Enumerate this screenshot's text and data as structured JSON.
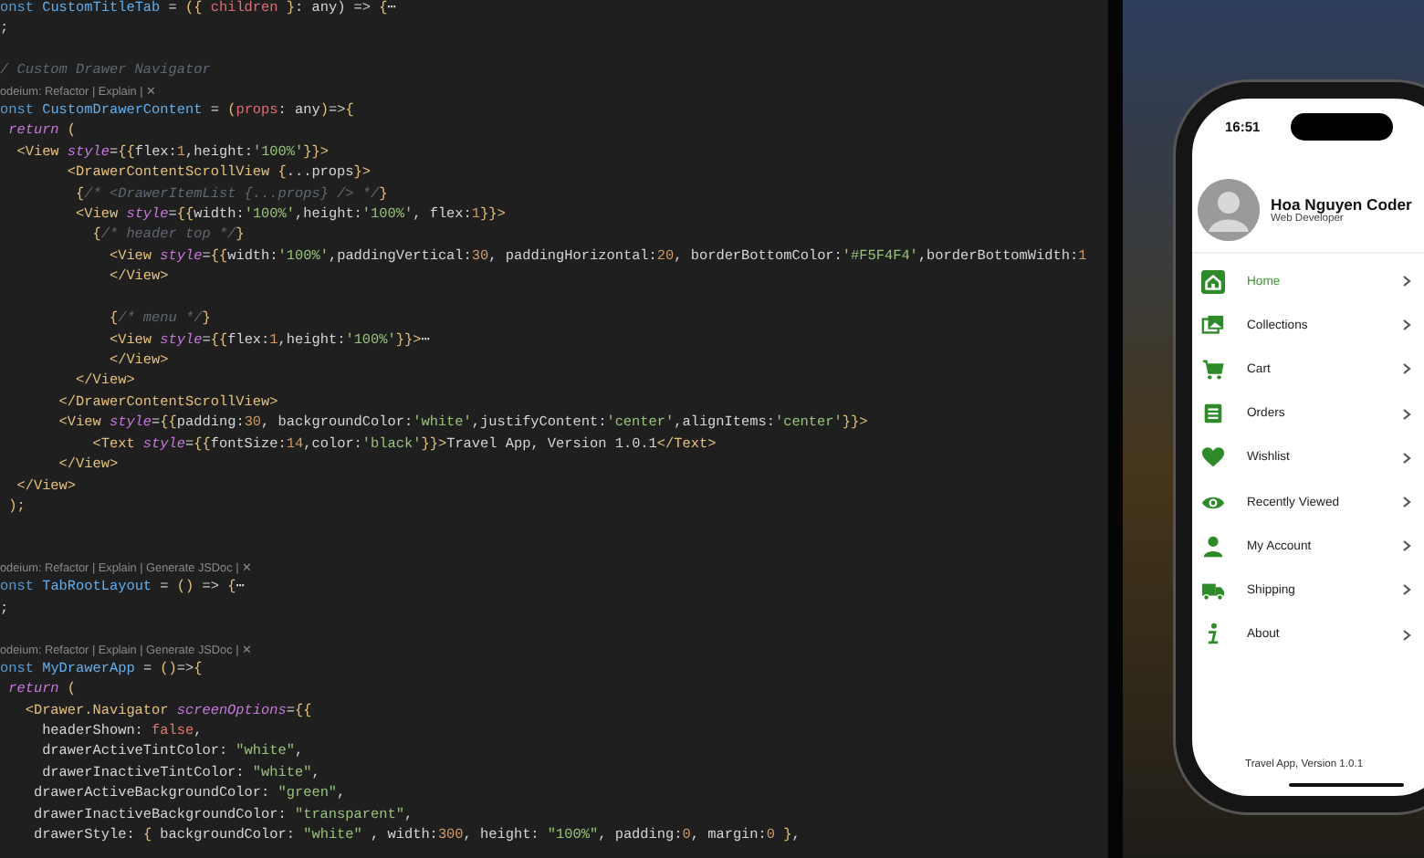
{
  "editor": {
    "lines": [
      {
        "kind": "code",
        "tokens": [
          {
            "text": "onst ",
            "kind": "keyword"
          },
          {
            "text": "CustomTitleTab",
            "kind": "name"
          },
          {
            "text": " = ",
            "kind": "operator"
          },
          {
            "text": "({ ",
            "kind": "brace"
          },
          {
            "text": "children",
            "kind": "param"
          },
          {
            "text": " }",
            "kind": "brace"
          },
          {
            "text": ": any) ",
            "kind": "plain"
          },
          {
            "text": "=>",
            "kind": "operator"
          },
          {
            "text": " {",
            "kind": "brace"
          },
          {
            "text": "⋯",
            "kind": "plain"
          }
        ]
      },
      {
        "kind": "code",
        "tokens": [
          {
            "text": ";",
            "kind": "plain"
          }
        ]
      },
      {
        "kind": "blank"
      },
      {
        "kind": "code",
        "tokens": [
          {
            "text": "/ Custom Drawer Navigator",
            "kind": "comment"
          }
        ]
      },
      {
        "kind": "codelens",
        "text": "odeium: Refactor | Explain | ✕"
      },
      {
        "kind": "code",
        "tokens": [
          {
            "text": "onst ",
            "kind": "keyword"
          },
          {
            "text": "CustomDrawerContent",
            "kind": "name"
          },
          {
            "text": " = ",
            "kind": "operator"
          },
          {
            "text": "(",
            "kind": "brace"
          },
          {
            "text": "props",
            "kind": "param"
          },
          {
            "text": ": any",
            "kind": "plain"
          },
          {
            "text": ")",
            "kind": "brace"
          },
          {
            "text": "=>",
            "kind": "operator"
          },
          {
            "text": "{",
            "kind": "brace"
          }
        ]
      },
      {
        "kind": "code",
        "tokens": [
          {
            "text": " return",
            "kind": "control"
          },
          {
            "text": " (",
            "kind": "brace"
          }
        ]
      },
      {
        "kind": "code",
        "tokens": [
          {
            "text": "  <View",
            "kind": "tag"
          },
          {
            "text": " style",
            "kind": "attr"
          },
          {
            "text": "=",
            "kind": "operator"
          },
          {
            "text": "{{",
            "kind": "brace"
          },
          {
            "text": "flex:",
            "kind": "plain"
          },
          {
            "text": "1",
            "kind": "number"
          },
          {
            "text": ",height:",
            "kind": "plain"
          },
          {
            "text": "'100%'",
            "kind": "string"
          },
          {
            "text": "}}",
            "kind": "brace"
          },
          {
            "text": ">",
            "kind": "tag"
          }
        ]
      },
      {
        "kind": "code",
        "tokens": [
          {
            "text": "        <DrawerContentScrollView",
            "kind": "tag"
          },
          {
            "text": " {",
            "kind": "brace"
          },
          {
            "text": "...props",
            "kind": "plain"
          },
          {
            "text": "}",
            "kind": "brace"
          },
          {
            "text": ">",
            "kind": "tag"
          }
        ]
      },
      {
        "kind": "code",
        "tokens": [
          {
            "text": "         {",
            "kind": "brace"
          },
          {
            "text": "/* <DrawerItemList {...props} /> */",
            "kind": "comment"
          },
          {
            "text": "}",
            "kind": "brace"
          }
        ]
      },
      {
        "kind": "code",
        "tokens": [
          {
            "text": "         <View",
            "kind": "tag"
          },
          {
            "text": " style",
            "kind": "attr"
          },
          {
            "text": "=",
            "kind": "operator"
          },
          {
            "text": "{{",
            "kind": "brace"
          },
          {
            "text": "width:",
            "kind": "plain"
          },
          {
            "text": "'100%'",
            "kind": "string"
          },
          {
            "text": ",height:",
            "kind": "plain"
          },
          {
            "text": "'100%'",
            "kind": "string"
          },
          {
            "text": ", flex:",
            "kind": "plain"
          },
          {
            "text": "1",
            "kind": "number"
          },
          {
            "text": "}}",
            "kind": "brace"
          },
          {
            "text": ">",
            "kind": "tag"
          }
        ]
      },
      {
        "kind": "code",
        "tokens": [
          {
            "text": "           {",
            "kind": "brace"
          },
          {
            "text": "/* header top */",
            "kind": "comment"
          },
          {
            "text": "}",
            "kind": "brace"
          }
        ]
      },
      {
        "kind": "code",
        "tokens": [
          {
            "text": "             <View",
            "kind": "tag"
          },
          {
            "text": " style",
            "kind": "attr"
          },
          {
            "text": "=",
            "kind": "operator"
          },
          {
            "text": "{{",
            "kind": "brace"
          },
          {
            "text": "width:",
            "kind": "plain"
          },
          {
            "text": "'100%'",
            "kind": "string"
          },
          {
            "text": ",paddingVertical:",
            "kind": "plain"
          },
          {
            "text": "30",
            "kind": "number"
          },
          {
            "text": ", paddingHorizontal:",
            "kind": "plain"
          },
          {
            "text": "20",
            "kind": "number"
          },
          {
            "text": ", borderBottomColor:",
            "kind": "plain"
          },
          {
            "text": "'#F5F4F4'",
            "kind": "string"
          },
          {
            "text": ",borderBottomWidth:",
            "kind": "plain"
          },
          {
            "text": "1",
            "kind": "number"
          }
        ]
      },
      {
        "kind": "code",
        "tokens": [
          {
            "text": "             </View>",
            "kind": "tag"
          }
        ]
      },
      {
        "kind": "blank"
      },
      {
        "kind": "code",
        "tokens": [
          {
            "text": "             {",
            "kind": "brace"
          },
          {
            "text": "/* menu */",
            "kind": "comment"
          },
          {
            "text": "}",
            "kind": "brace"
          }
        ]
      },
      {
        "kind": "code",
        "tokens": [
          {
            "text": "             <View",
            "kind": "tag"
          },
          {
            "text": " style",
            "kind": "attr"
          },
          {
            "text": "=",
            "kind": "operator"
          },
          {
            "text": "{{",
            "kind": "brace"
          },
          {
            "text": "flex:",
            "kind": "plain"
          },
          {
            "text": "1",
            "kind": "number"
          },
          {
            "text": ",height:",
            "kind": "plain"
          },
          {
            "text": "'100%'",
            "kind": "string"
          },
          {
            "text": "}}",
            "kind": "brace"
          },
          {
            "text": ">",
            "kind": "tag"
          },
          {
            "text": "⋯",
            "kind": "plain"
          }
        ]
      },
      {
        "kind": "code",
        "tokens": [
          {
            "text": "             </View>",
            "kind": "tag"
          }
        ]
      },
      {
        "kind": "code",
        "tokens": [
          {
            "text": "         </View>",
            "kind": "tag"
          }
        ]
      },
      {
        "kind": "code",
        "tokens": [
          {
            "text": "       </DrawerContentScrollView>",
            "kind": "tag"
          }
        ]
      },
      {
        "kind": "code",
        "tokens": [
          {
            "text": "       <View",
            "kind": "tag"
          },
          {
            "text": " style",
            "kind": "attr"
          },
          {
            "text": "=",
            "kind": "operator"
          },
          {
            "text": "{{",
            "kind": "brace"
          },
          {
            "text": "padding:",
            "kind": "plain"
          },
          {
            "text": "30",
            "kind": "number"
          },
          {
            "text": ", backgroundColor:",
            "kind": "plain"
          },
          {
            "text": "'white'",
            "kind": "string"
          },
          {
            "text": ",justifyContent:",
            "kind": "plain"
          },
          {
            "text": "'center'",
            "kind": "string"
          },
          {
            "text": ",alignItems:",
            "kind": "plain"
          },
          {
            "text": "'center'",
            "kind": "string"
          },
          {
            "text": "}}",
            "kind": "brace"
          },
          {
            "text": ">",
            "kind": "tag"
          }
        ]
      },
      {
        "kind": "code",
        "tokens": [
          {
            "text": "           <Text",
            "kind": "tag"
          },
          {
            "text": " style",
            "kind": "attr"
          },
          {
            "text": "=",
            "kind": "operator"
          },
          {
            "text": "{{",
            "kind": "brace"
          },
          {
            "text": "fontSize:",
            "kind": "plain"
          },
          {
            "text": "14",
            "kind": "number"
          },
          {
            "text": ",color:",
            "kind": "plain"
          },
          {
            "text": "'black'",
            "kind": "string"
          },
          {
            "text": "}}",
            "kind": "brace"
          },
          {
            "text": ">",
            "kind": "tag"
          },
          {
            "text": "Travel App, Version 1.0.1",
            "kind": "plain"
          },
          {
            "text": "</Text>",
            "kind": "tag"
          }
        ]
      },
      {
        "kind": "code",
        "tokens": [
          {
            "text": "       </View>",
            "kind": "tag"
          }
        ]
      },
      {
        "kind": "code",
        "tokens": [
          {
            "text": "  </View>",
            "kind": "tag"
          }
        ]
      },
      {
        "kind": "code",
        "tokens": [
          {
            "text": " );",
            "kind": "brace"
          }
        ]
      },
      {
        "kind": "blank"
      },
      {
        "kind": "blank"
      },
      {
        "kind": "codelens",
        "text": "odeium: Refactor | Explain | Generate JSDoc | ✕"
      },
      {
        "kind": "code",
        "tokens": [
          {
            "text": "onst ",
            "kind": "keyword"
          },
          {
            "text": "TabRootLayout",
            "kind": "name"
          },
          {
            "text": " = ",
            "kind": "operator"
          },
          {
            "text": "() ",
            "kind": "brace"
          },
          {
            "text": "=>",
            "kind": "operator"
          },
          {
            "text": " {",
            "kind": "brace"
          },
          {
            "text": "⋯",
            "kind": "plain"
          }
        ]
      },
      {
        "kind": "code",
        "tokens": [
          {
            "text": ";",
            "kind": "plain"
          }
        ]
      },
      {
        "kind": "blank"
      },
      {
        "kind": "codelens",
        "text": "odeium: Refactor | Explain | Generate JSDoc | ✕"
      },
      {
        "kind": "code",
        "tokens": [
          {
            "text": "onst ",
            "kind": "keyword"
          },
          {
            "text": "MyDrawerApp",
            "kind": "name"
          },
          {
            "text": " = ",
            "kind": "operator"
          },
          {
            "text": "()",
            "kind": "brace"
          },
          {
            "text": "=>",
            "kind": "operator"
          },
          {
            "text": "{",
            "kind": "brace"
          }
        ]
      },
      {
        "kind": "code",
        "tokens": [
          {
            "text": " return",
            "kind": "control"
          },
          {
            "text": " (",
            "kind": "brace"
          }
        ]
      },
      {
        "kind": "code",
        "tokens": [
          {
            "text": "   <Drawer.Navigator",
            "kind": "tag"
          },
          {
            "text": " screenOptions",
            "kind": "attr"
          },
          {
            "text": "=",
            "kind": "operator"
          },
          {
            "text": "{{",
            "kind": "brace"
          }
        ]
      },
      {
        "kind": "code",
        "tokens": [
          {
            "text": "     headerShown: ",
            "kind": "plain"
          },
          {
            "text": "false",
            "kind": "literal"
          },
          {
            "text": ",",
            "kind": "plain"
          }
        ]
      },
      {
        "kind": "code",
        "tokens": [
          {
            "text": "     drawerActiveTintColor: ",
            "kind": "plain"
          },
          {
            "text": "\"white\"",
            "kind": "string"
          },
          {
            "text": ",",
            "kind": "plain"
          }
        ]
      },
      {
        "kind": "code",
        "tokens": [
          {
            "text": "     drawerInactiveTintColor: ",
            "kind": "plain"
          },
          {
            "text": "\"white\"",
            "kind": "string"
          },
          {
            "text": ",",
            "kind": "plain"
          }
        ]
      },
      {
        "kind": "code",
        "tokens": [
          {
            "text": "    drawerActiveBackgroundColor: ",
            "kind": "plain"
          },
          {
            "text": "\"green\"",
            "kind": "string"
          },
          {
            "text": ",",
            "kind": "plain"
          }
        ]
      },
      {
        "kind": "code",
        "tokens": [
          {
            "text": "    drawerInactiveBackgroundColor: ",
            "kind": "plain"
          },
          {
            "text": "\"transparent\"",
            "kind": "string"
          },
          {
            "text": ",",
            "kind": "plain"
          }
        ]
      },
      {
        "kind": "code",
        "tokens": [
          {
            "text": "    drawerStyle: ",
            "kind": "plain"
          },
          {
            "text": "{ ",
            "kind": "brace"
          },
          {
            "text": "backgroundColor: ",
            "kind": "plain"
          },
          {
            "text": "\"white\"",
            "kind": "string"
          },
          {
            "text": " , width:",
            "kind": "plain"
          },
          {
            "text": "300",
            "kind": "number"
          },
          {
            "text": ", height: ",
            "kind": "plain"
          },
          {
            "text": "\"100%\"",
            "kind": "string"
          },
          {
            "text": ", padding:",
            "kind": "plain"
          },
          {
            "text": "0",
            "kind": "number"
          },
          {
            "text": ", margin:",
            "kind": "plain"
          },
          {
            "text": "0",
            "kind": "number"
          },
          {
            "text": " }",
            "kind": "brace"
          },
          {
            "text": ",",
            "kind": "plain"
          }
        ]
      }
    ]
  },
  "phone": {
    "status_time": "16:51",
    "profile": {
      "name": "Hoa Nguyen Coder",
      "role": "Web Developer"
    },
    "menu": [
      {
        "label": "Home",
        "selected": true
      },
      {
        "label": "Collections",
        "selected": false
      },
      {
        "label": "Cart",
        "selected": false
      },
      {
        "label": "Orders",
        "selected": false
      },
      {
        "label": "Wishlist",
        "selected": false
      },
      {
        "label": "Recently Viewed",
        "selected": false
      },
      {
        "label": "My Account",
        "selected": false
      },
      {
        "label": "Shipping",
        "selected": false
      },
      {
        "label": "About",
        "selected": false
      }
    ],
    "footer": "Travel App, Version 1.0.1"
  }
}
